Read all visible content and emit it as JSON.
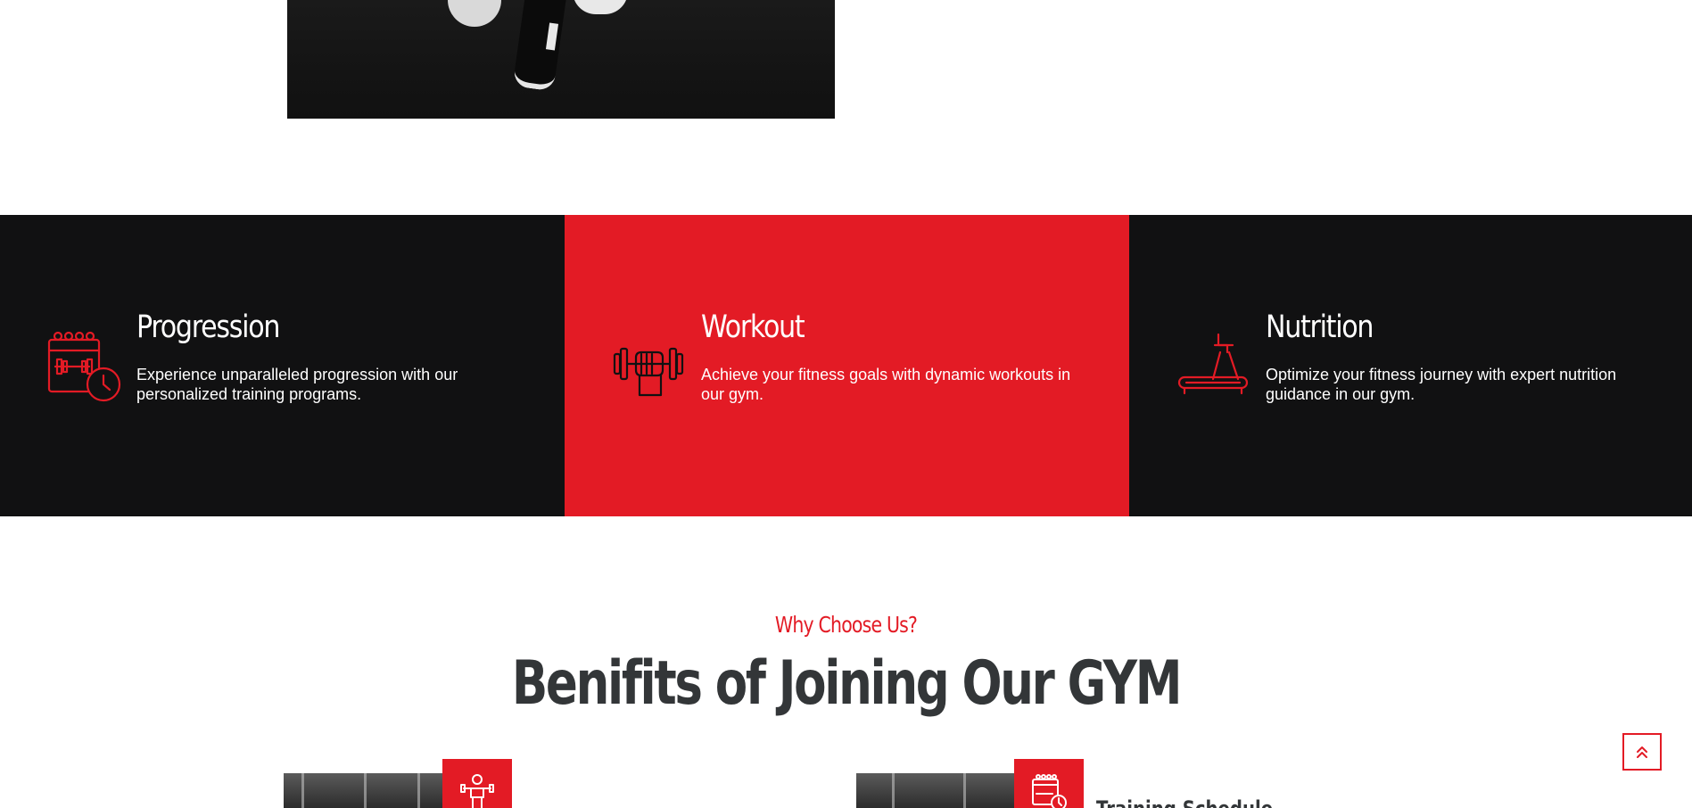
{
  "features": [
    {
      "title": "Progression",
      "text": "Experience unparalleled progression with our personalized training programs.",
      "icon": "calendar-clock-icon",
      "style": "dark"
    },
    {
      "title": "Workout",
      "text": "Achieve your fitness goals with dynamic workouts in our gym.",
      "icon": "dumbbell-hand-icon",
      "style": "red"
    },
    {
      "title": "Nutrition",
      "text": "Optimize your fitness journey with expert nutrition guidance in our gym.",
      "icon": "treadmill-icon",
      "style": "dark"
    }
  ],
  "benefits": {
    "eyebrow": "Why Choose Us?",
    "title": "Benifits of Joining Our GYM",
    "items": [
      {
        "icon": "trainer-icon",
        "heading": ""
      },
      {
        "icon": "calendar-clock-icon",
        "heading": "Training Schedule"
      }
    ]
  },
  "back_to_top": {
    "icon": "double-chevron-up-icon"
  },
  "colors": {
    "accent": "#e31b25",
    "dark": "#111112",
    "heading": "#333638",
    "white": "#ffffff"
  }
}
